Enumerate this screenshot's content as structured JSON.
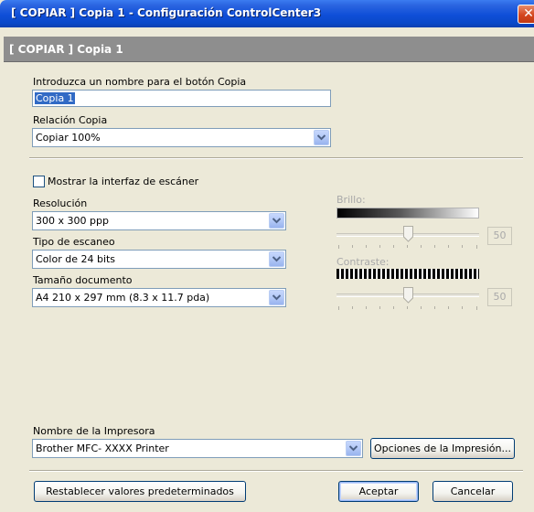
{
  "window": {
    "title": "[ COPIAR ]  Copia 1 - Configuración ControlCenter3",
    "close_icon": "close-x-icon"
  },
  "header": {
    "title": "[ COPIAR ]  Copia 1"
  },
  "copy_name": {
    "label": "Introduzca un nombre para el botón Copia",
    "value": "Copia 1"
  },
  "copy_ratio": {
    "label": "Relación Copia",
    "value": "Copiar 100%"
  },
  "scanner": {
    "show_interface_label": "Mostrar la interfaz de escáner",
    "show_interface_checked": false,
    "resolution_label": "Resolución",
    "resolution_value": "300 x 300 ppp",
    "scan_type_label": "Tipo de escaneo",
    "scan_type_value": "Color de 24 bits",
    "doc_size_label": "Tamaño documento",
    "doc_size_value": "A4 210 x 297 mm (8.3 x 11.7 pda)",
    "brightness_label": "Brillo:",
    "brightness_value": "50",
    "contrast_label": "Contraste:",
    "contrast_value": "50"
  },
  "printer": {
    "label": "Nombre de la Impresora",
    "value": "Brother MFC- XXXX Printer",
    "options_button": "Opciones de la Impresión..."
  },
  "footer": {
    "reset_button": "Restablecer valores predeterminados",
    "ok_button": "Aceptar",
    "cancel_button": "Cancelar"
  },
  "colors": {
    "title_bar": "#0f4fd8",
    "header_band": "#8e8e8e",
    "selection": "#316ac5",
    "dialog_bg": "#ece9d8"
  }
}
